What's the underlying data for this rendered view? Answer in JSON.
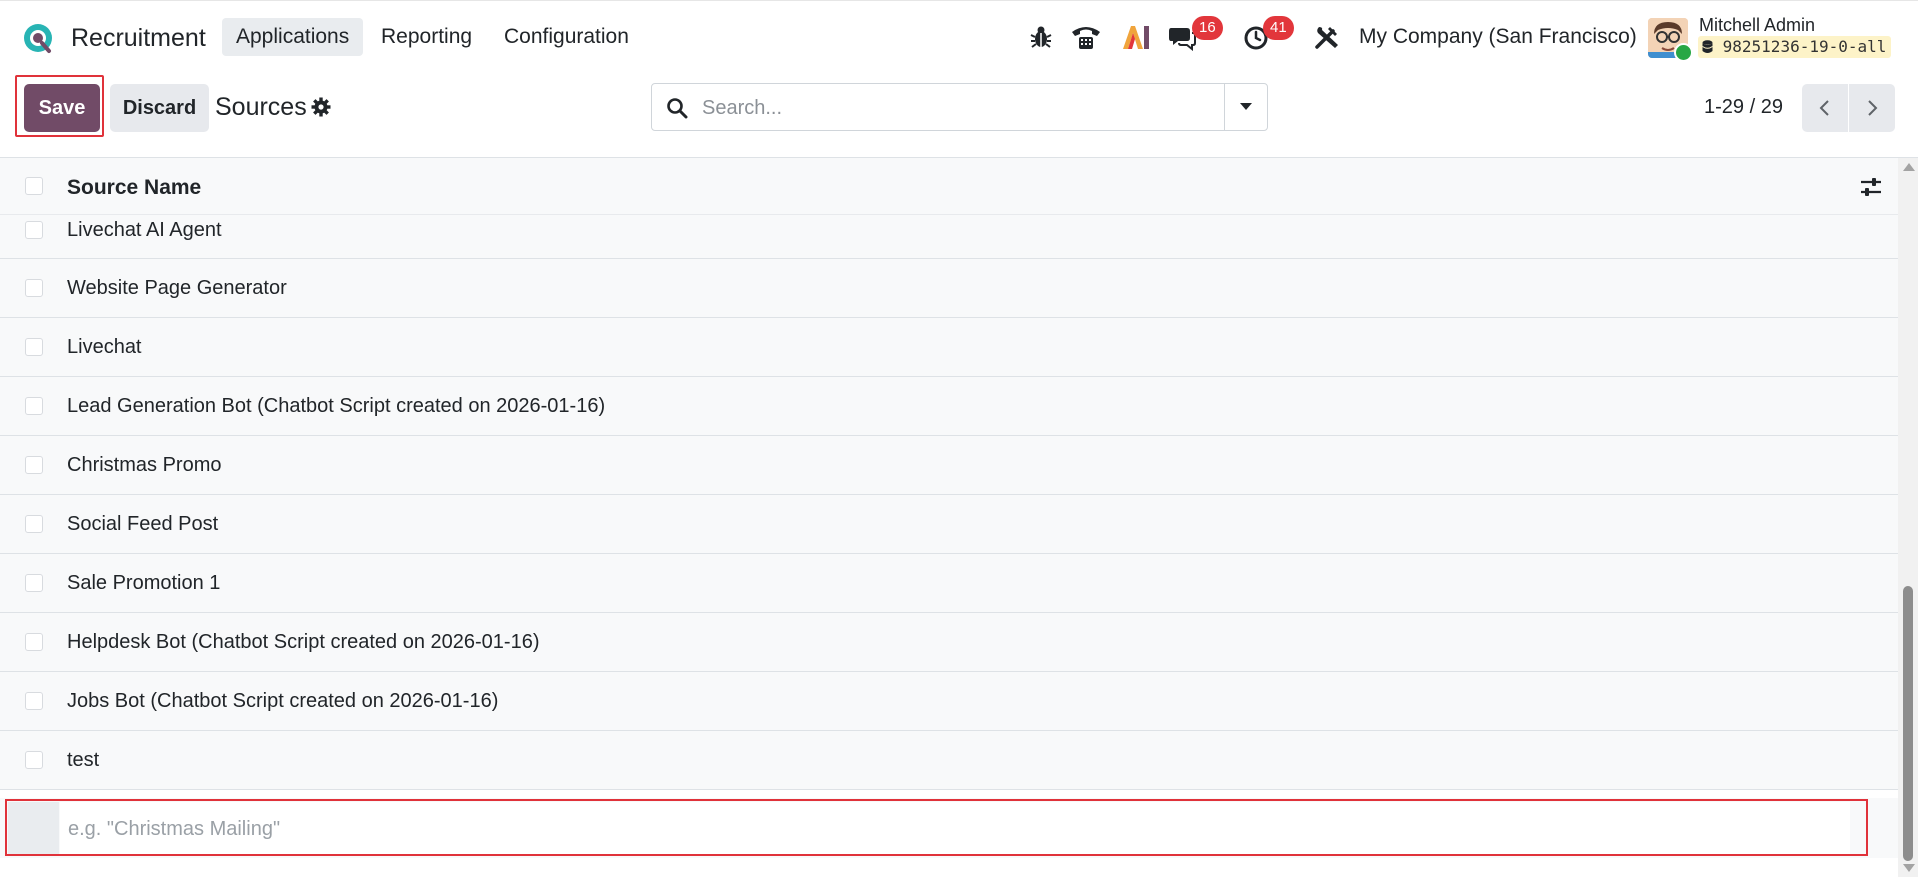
{
  "navbar": {
    "app_name": "Recruitment",
    "menu": [
      {
        "label": "Applications",
        "active": true
      },
      {
        "label": "Reporting",
        "active": false
      },
      {
        "label": "Configuration",
        "active": false
      }
    ],
    "icons": [
      "bug-icon",
      "phone-icon",
      "ai-icon",
      "chat-icon",
      "activity-clock-icon",
      "tools-icon"
    ],
    "messages_badge": "16",
    "activities_badge": "41",
    "company": "My Company (San Francisco)",
    "user_name": "Mitchell Admin",
    "database": "98251236-19-0-all",
    "accent_color": "#714b67",
    "badge_color": "#e2363b"
  },
  "toolbar": {
    "save_label": "Save",
    "discard_label": "Discard",
    "title": "Sources",
    "search_placeholder": "Search...",
    "pager_value": "1-29 / 29"
  },
  "list": {
    "column_header": "Source Name",
    "rows": [
      "Livechat AI Agent",
      "Website Page Generator",
      "Livechat",
      "Lead Generation Bot (Chatbot Script created on 2026-01-16)",
      "Christmas Promo",
      "Social Feed Post",
      "Sale Promotion 1",
      "Helpdesk Bot (Chatbot Script created on 2026-01-16)",
      "Jobs Bot (Chatbot Script created on 2026-01-16)",
      "test"
    ],
    "new_row_placeholder": "e.g. \"Christmas Mailing\""
  }
}
